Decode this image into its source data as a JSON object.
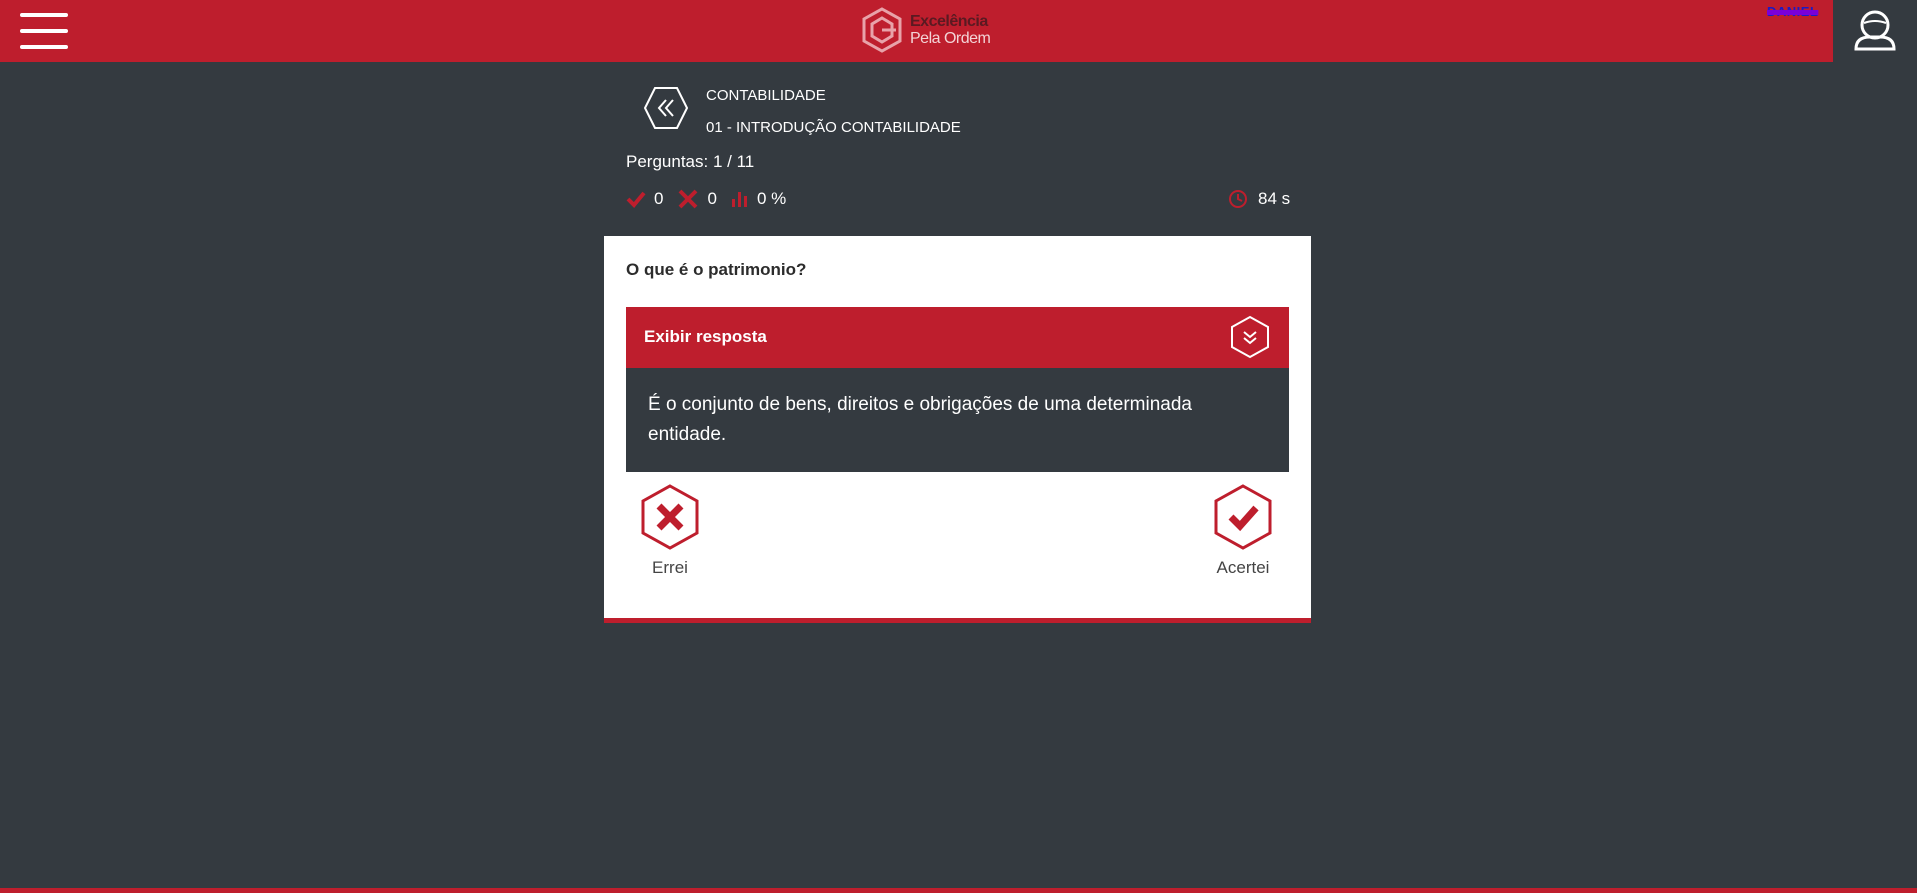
{
  "header": {
    "logo_line1": "Excelência",
    "logo_line2": "Pela Ordem",
    "user_name": "DANIEL"
  },
  "breadcrumb": {
    "subject": "CONTABILIDADE",
    "deck": "01 - INTRODUÇÃO CONTABILIDADE"
  },
  "progress": {
    "label": "Perguntas: 1 / 11",
    "correct": "0",
    "wrong": "0",
    "percent": "0 %",
    "timer": "84 s"
  },
  "card": {
    "question": "O que é o patrimonio?",
    "reveal_label": "Exibir resposta",
    "answer": "É o conjunto de bens, direitos e obrigações de uma determinada entidade.",
    "wrong_label": "Errei",
    "right_label": "Acertei"
  },
  "colors": {
    "brand_red": "#be1e2d",
    "background": "#343a40",
    "card": "#ffffff"
  },
  "icons": [
    "menu-icon",
    "logo-icon",
    "user-icon",
    "back-double-chevron-icon",
    "check-icon",
    "x-icon",
    "bar-chart-icon",
    "clock-icon",
    "double-chevron-down-icon"
  ]
}
